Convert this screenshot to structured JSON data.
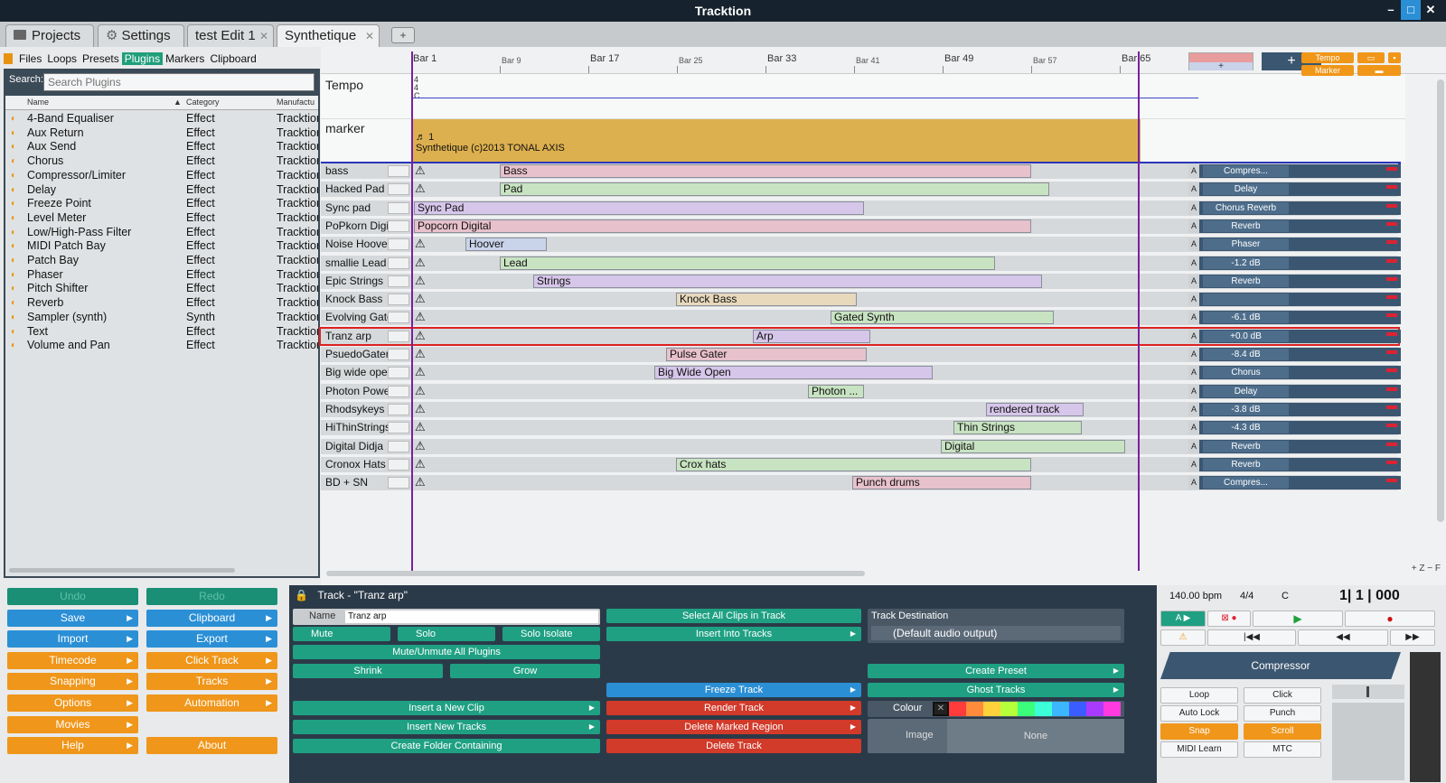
{
  "app": {
    "title": "Tracktion"
  },
  "tabs": [
    {
      "label": "Projects"
    },
    {
      "label": "Settings"
    },
    {
      "label": "test Edit 1"
    },
    {
      "label": "Synthetique"
    }
  ],
  "browser_nav": [
    "Files",
    "Loops",
    "Presets",
    "Plugins",
    "Markers",
    "Clipboard"
  ],
  "search": {
    "label": "Search:",
    "placeholder": "Search Plugins"
  },
  "plugin_columns": [
    "Name",
    "Category",
    "Manufactu"
  ],
  "plugins": [
    {
      "name": "4-Band Equaliser",
      "category": "Effect",
      "maker": "Tracktion"
    },
    {
      "name": "Aux Return",
      "category": "Effect",
      "maker": "Tracktion"
    },
    {
      "name": "Aux Send",
      "category": "Effect",
      "maker": "Tracktion"
    },
    {
      "name": "Chorus",
      "category": "Effect",
      "maker": "Tracktion"
    },
    {
      "name": "Compressor/Limiter",
      "category": "Effect",
      "maker": "Tracktion"
    },
    {
      "name": "Delay",
      "category": "Effect",
      "maker": "Tracktion"
    },
    {
      "name": "Freeze Point",
      "category": "Effect",
      "maker": "Tracktion"
    },
    {
      "name": "Level Meter",
      "category": "Effect",
      "maker": "Tracktion"
    },
    {
      "name": "Low/High-Pass Filter",
      "category": "Effect",
      "maker": "Tracktion"
    },
    {
      "name": "MIDI Patch Bay",
      "category": "Effect",
      "maker": "Tracktion"
    },
    {
      "name": "Patch Bay",
      "category": "Effect",
      "maker": "Tracktion"
    },
    {
      "name": "Phaser",
      "category": "Effect",
      "maker": "Tracktion"
    },
    {
      "name": "Pitch Shifter",
      "category": "Effect",
      "maker": "Tracktion"
    },
    {
      "name": "Reverb",
      "category": "Effect",
      "maker": "Tracktion"
    },
    {
      "name": "Sampler (synth)",
      "category": "Synth",
      "maker": "Tracktion"
    },
    {
      "name": "Text",
      "category": "Effect",
      "maker": "Tracktion"
    },
    {
      "name": "Volume and Pan",
      "category": "Effect",
      "maker": "Tracktion"
    }
  ],
  "ruler": [
    "Bar 1",
    "Bar 9",
    "Bar 17",
    "Bar 25",
    "Bar 33",
    "Bar 41",
    "Bar 49",
    "Bar 57",
    "Bar 65"
  ],
  "tempo": {
    "label": "Tempo",
    "sig": "4\n4\nC"
  },
  "marker": {
    "label": "marker",
    "number": "1",
    "text": "Synthetique (c)2013 TONAL AXIS"
  },
  "tempo_buttons": {
    "tempo": "Tempo",
    "marker": "Marker"
  },
  "tracks": [
    {
      "name": "bass",
      "clip": "Bass",
      "color": "pink",
      "plugin": "Compres...",
      "start": 198,
      "width": 588
    },
    {
      "name": "Hacked Pad",
      "clip": "Pad",
      "color": "green",
      "plugin": "Delay",
      "start": 198,
      "width": 608
    },
    {
      "name": "Sync pad",
      "clip": "Sync Pad",
      "color": "purple",
      "plugin": "Chorus  Reverb",
      "start": 103,
      "width": 498
    },
    {
      "name": "PoPkorn Digital",
      "clip": "Popcorn Digital",
      "color": "pink",
      "plugin": "Reverb",
      "start": 103,
      "width": 683
    },
    {
      "name": "Noise Hoover",
      "clip": "Hoover",
      "color": "blue",
      "plugin": "Phaser",
      "start": 160,
      "width": 90
    },
    {
      "name": "smallie Lead",
      "clip": "Lead",
      "color": "green",
      "plugin": "-1.2 dB",
      "start": 198,
      "width": 548
    },
    {
      "name": "Epic Strings",
      "clip": "Strings",
      "color": "purple",
      "plugin": "Reverb",
      "start": 235,
      "width": 563
    },
    {
      "name": "Knock Bass",
      "clip": "Knock Bass",
      "color": "tan",
      "plugin": "",
      "start": 393,
      "width": 200
    },
    {
      "name": "Evolving Gate",
      "clip": "Gated Synth",
      "color": "green",
      "plugin": "-6.1 dB",
      "start": 564,
      "width": 247
    },
    {
      "name": "Tranz arp",
      "clip": "Arp",
      "color": "purple",
      "plugin": "+0.0 dB",
      "start": 478,
      "width": 130
    },
    {
      "name": "PsuedoGater",
      "clip": "Pulse Gater",
      "color": "pink",
      "plugin": "-8.4 dB",
      "start": 382,
      "width": 222
    },
    {
      "name": "Big wide open",
      "clip": "Big Wide Open",
      "color": "purple",
      "plugin": "Chorus",
      "start": 369,
      "width": 308
    },
    {
      "name": "Photon Power",
      "clip": "Photon ...",
      "color": "green",
      "plugin": "Delay",
      "start": 539,
      "width": 62
    },
    {
      "name": "Rhodsykeys",
      "clip": "rendered track",
      "color": "purple",
      "plugin": "-3.8 dB",
      "start": 736,
      "width": 108
    },
    {
      "name": "HiThinStrings",
      "clip": "Thin Strings",
      "color": "green",
      "plugin": "-4.3 dB",
      "start": 700,
      "width": 142
    },
    {
      "name": "Digital Didja",
      "clip": "Digital",
      "color": "green",
      "plugin": "Reverb",
      "start": 686,
      "width": 204
    },
    {
      "name": "Cronox Hats",
      "clip": "Crox hats",
      "color": "green",
      "plugin": "Reverb",
      "start": 393,
      "width": 393
    },
    {
      "name": "BD + SN",
      "clip": "Punch drums",
      "color": "pink",
      "plugin": "Compres...",
      "start": 588,
      "width": 198
    }
  ],
  "left_buttons": [
    {
      "label": "Undo",
      "style": "dim"
    },
    {
      "label": "Redo",
      "style": "dim"
    },
    {
      "label": "Save",
      "style": "blue"
    },
    {
      "label": "Clipboard",
      "style": "blue"
    },
    {
      "label": "Import",
      "style": "blue"
    },
    {
      "label": "Export",
      "style": "blue"
    },
    {
      "label": "Timecode",
      "style": "orange"
    },
    {
      "label": "Click Track",
      "style": "orange"
    },
    {
      "label": "Snapping",
      "style": "orange"
    },
    {
      "label": "Tracks",
      "style": "orange"
    },
    {
      "label": "Options",
      "style": "orange"
    },
    {
      "label": "Automation",
      "style": "orange"
    },
    {
      "label": "Movies",
      "style": "orange"
    },
    {
      "label": "",
      "style": "none"
    },
    {
      "label": "Help",
      "style": "orange"
    },
    {
      "label": "About",
      "style": "orange"
    }
  ],
  "track_panel": {
    "title": "Track - \"Tranz arp\"",
    "name_label": "Name",
    "name_value": "Tranz arp",
    "mute": "Mute",
    "solo": "Solo",
    "solo_isolate": "Solo Isolate",
    "mute_all": "Mute/Unmute All Plugins",
    "shrink": "Shrink",
    "grow": "Grow",
    "insert_clip": "Insert a New Clip",
    "insert_tracks": "Insert New Tracks",
    "create_folder": "Create Folder Containing",
    "select_all": "Select All Clips in Track",
    "insert_into": "Insert Into Tracks",
    "freeze": "Freeze Track",
    "render": "Render Track",
    "delete_region": "Delete Marked Region",
    "delete_track": "Delete Track",
    "dest_label": "Track Destination",
    "dest_value": "(Default audio output)",
    "create_preset": "Create Preset",
    "ghost_tracks": "Ghost Tracks",
    "colour": "Colour",
    "image": "Image",
    "none": "None",
    "swatches": [
      "#ff3b3b",
      "#ff8c3b",
      "#ffd23b",
      "#b6ff3b",
      "#3bff7a",
      "#3bffd8",
      "#3bb6ff",
      "#3b5cff",
      "#a83bff",
      "#ff3be0"
    ]
  },
  "transport": {
    "bpm": "140.00 bpm",
    "sig": "4/4",
    "key": "C",
    "position": "1|  1  | 000",
    "plugin": "Compressor",
    "loop": "Loop",
    "click": "Click",
    "auto_lock": "Auto Lock",
    "punch": "Punch",
    "snap": "Snap",
    "scroll": "Scroll",
    "midi_learn": "MIDI Learn",
    "mtc": "MTC"
  }
}
